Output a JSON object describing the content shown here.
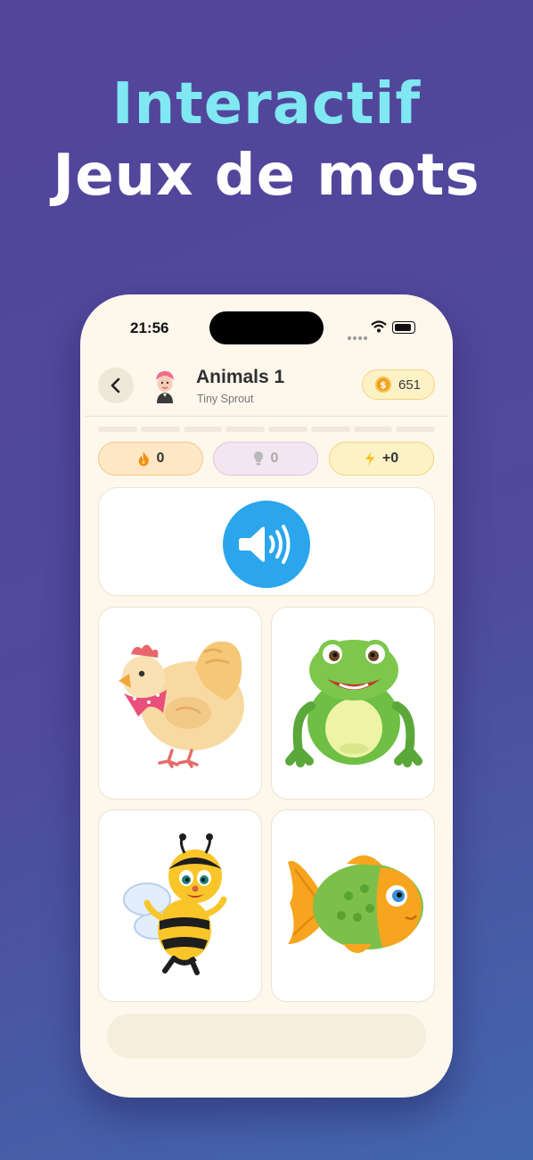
{
  "headline": {
    "line1": "Interactif",
    "line2": "Jeux de mots"
  },
  "status_bar": {
    "time": "21:56"
  },
  "header": {
    "title": "Animals 1",
    "subtitle": "Tiny Sprout",
    "coins": "651"
  },
  "stats": {
    "streak": "0",
    "hints": "0",
    "bonus": "+0"
  },
  "choices": [
    {
      "name": "chicken"
    },
    {
      "name": "frog"
    },
    {
      "name": "bee"
    },
    {
      "name": "fish"
    }
  ],
  "colors": {
    "accent": "#2ba6ec",
    "background": "#fdf7ec",
    "headline_cyan": "#7fe8f2"
  }
}
